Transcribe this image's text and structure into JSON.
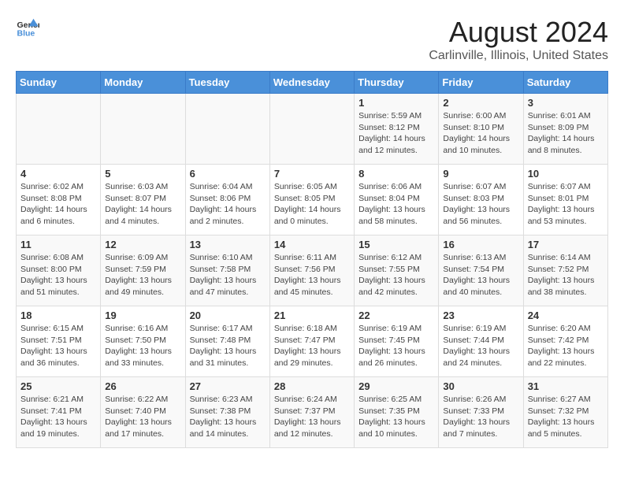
{
  "header": {
    "logo_line1": "General",
    "logo_line2": "Blue",
    "title": "August 2024",
    "subtitle": "Carlinville, Illinois, United States"
  },
  "weekdays": [
    "Sunday",
    "Monday",
    "Tuesday",
    "Wednesday",
    "Thursday",
    "Friday",
    "Saturday"
  ],
  "weeks": [
    [
      {
        "day": "",
        "info": ""
      },
      {
        "day": "",
        "info": ""
      },
      {
        "day": "",
        "info": ""
      },
      {
        "day": "",
        "info": ""
      },
      {
        "day": "1",
        "info": "Sunrise: 5:59 AM\nSunset: 8:12 PM\nDaylight: 14 hours\nand 12 minutes."
      },
      {
        "day": "2",
        "info": "Sunrise: 6:00 AM\nSunset: 8:10 PM\nDaylight: 14 hours\nand 10 minutes."
      },
      {
        "day": "3",
        "info": "Sunrise: 6:01 AM\nSunset: 8:09 PM\nDaylight: 14 hours\nand 8 minutes."
      }
    ],
    [
      {
        "day": "4",
        "info": "Sunrise: 6:02 AM\nSunset: 8:08 PM\nDaylight: 14 hours\nand 6 minutes."
      },
      {
        "day": "5",
        "info": "Sunrise: 6:03 AM\nSunset: 8:07 PM\nDaylight: 14 hours\nand 4 minutes."
      },
      {
        "day": "6",
        "info": "Sunrise: 6:04 AM\nSunset: 8:06 PM\nDaylight: 14 hours\nand 2 minutes."
      },
      {
        "day": "7",
        "info": "Sunrise: 6:05 AM\nSunset: 8:05 PM\nDaylight: 14 hours\nand 0 minutes."
      },
      {
        "day": "8",
        "info": "Sunrise: 6:06 AM\nSunset: 8:04 PM\nDaylight: 13 hours\nand 58 minutes."
      },
      {
        "day": "9",
        "info": "Sunrise: 6:07 AM\nSunset: 8:03 PM\nDaylight: 13 hours\nand 56 minutes."
      },
      {
        "day": "10",
        "info": "Sunrise: 6:07 AM\nSunset: 8:01 PM\nDaylight: 13 hours\nand 53 minutes."
      }
    ],
    [
      {
        "day": "11",
        "info": "Sunrise: 6:08 AM\nSunset: 8:00 PM\nDaylight: 13 hours\nand 51 minutes."
      },
      {
        "day": "12",
        "info": "Sunrise: 6:09 AM\nSunset: 7:59 PM\nDaylight: 13 hours\nand 49 minutes."
      },
      {
        "day": "13",
        "info": "Sunrise: 6:10 AM\nSunset: 7:58 PM\nDaylight: 13 hours\nand 47 minutes."
      },
      {
        "day": "14",
        "info": "Sunrise: 6:11 AM\nSunset: 7:56 PM\nDaylight: 13 hours\nand 45 minutes."
      },
      {
        "day": "15",
        "info": "Sunrise: 6:12 AM\nSunset: 7:55 PM\nDaylight: 13 hours\nand 42 minutes."
      },
      {
        "day": "16",
        "info": "Sunrise: 6:13 AM\nSunset: 7:54 PM\nDaylight: 13 hours\nand 40 minutes."
      },
      {
        "day": "17",
        "info": "Sunrise: 6:14 AM\nSunset: 7:52 PM\nDaylight: 13 hours\nand 38 minutes."
      }
    ],
    [
      {
        "day": "18",
        "info": "Sunrise: 6:15 AM\nSunset: 7:51 PM\nDaylight: 13 hours\nand 36 minutes."
      },
      {
        "day": "19",
        "info": "Sunrise: 6:16 AM\nSunset: 7:50 PM\nDaylight: 13 hours\nand 33 minutes."
      },
      {
        "day": "20",
        "info": "Sunrise: 6:17 AM\nSunset: 7:48 PM\nDaylight: 13 hours\nand 31 minutes."
      },
      {
        "day": "21",
        "info": "Sunrise: 6:18 AM\nSunset: 7:47 PM\nDaylight: 13 hours\nand 29 minutes."
      },
      {
        "day": "22",
        "info": "Sunrise: 6:19 AM\nSunset: 7:45 PM\nDaylight: 13 hours\nand 26 minutes."
      },
      {
        "day": "23",
        "info": "Sunrise: 6:19 AM\nSunset: 7:44 PM\nDaylight: 13 hours\nand 24 minutes."
      },
      {
        "day": "24",
        "info": "Sunrise: 6:20 AM\nSunset: 7:42 PM\nDaylight: 13 hours\nand 22 minutes."
      }
    ],
    [
      {
        "day": "25",
        "info": "Sunrise: 6:21 AM\nSunset: 7:41 PM\nDaylight: 13 hours\nand 19 minutes."
      },
      {
        "day": "26",
        "info": "Sunrise: 6:22 AM\nSunset: 7:40 PM\nDaylight: 13 hours\nand 17 minutes."
      },
      {
        "day": "27",
        "info": "Sunrise: 6:23 AM\nSunset: 7:38 PM\nDaylight: 13 hours\nand 14 minutes."
      },
      {
        "day": "28",
        "info": "Sunrise: 6:24 AM\nSunset: 7:37 PM\nDaylight: 13 hours\nand 12 minutes."
      },
      {
        "day": "29",
        "info": "Sunrise: 6:25 AM\nSunset: 7:35 PM\nDaylight: 13 hours\nand 10 minutes."
      },
      {
        "day": "30",
        "info": "Sunrise: 6:26 AM\nSunset: 7:33 PM\nDaylight: 13 hours\nand 7 minutes."
      },
      {
        "day": "31",
        "info": "Sunrise: 6:27 AM\nSunset: 7:32 PM\nDaylight: 13 hours\nand 5 minutes."
      }
    ]
  ]
}
